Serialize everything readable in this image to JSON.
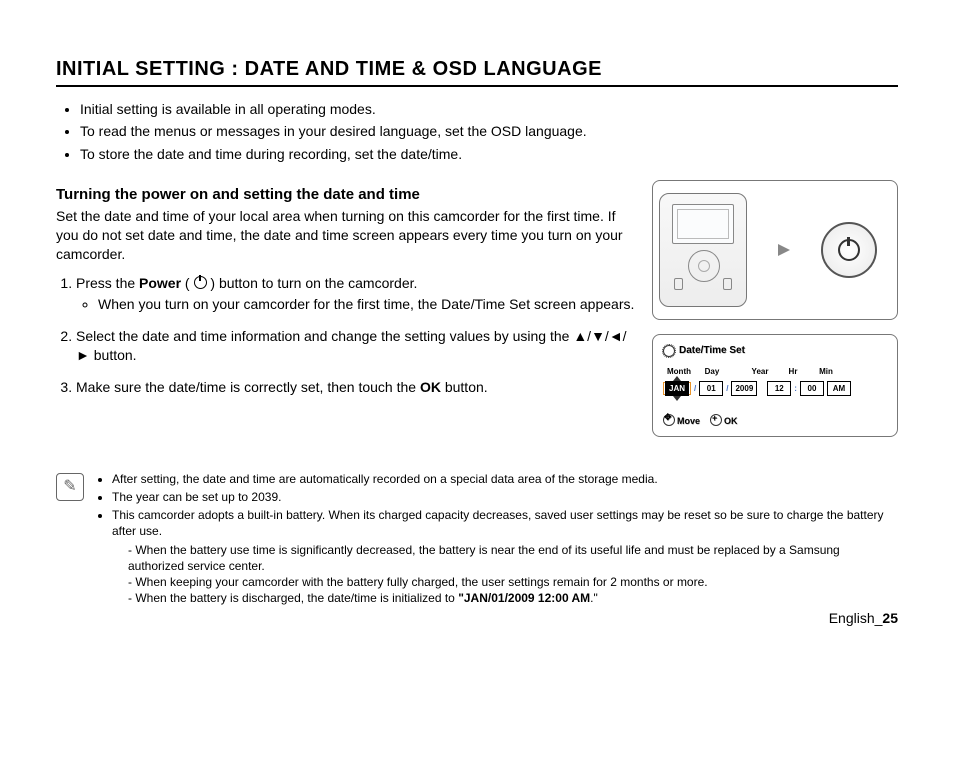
{
  "title": "INITIAL SETTING : DATE AND TIME & OSD LANGUAGE",
  "intro": {
    "i1": "Initial setting is available in all operating modes.",
    "i2": "To read the menus or messages in your desired language, set the OSD language.",
    "i3": "To store the date and time during recording, set the date/time."
  },
  "section": {
    "heading": "Turning the power on and setting the date and time",
    "body": "Set the date and time of your local area when turning on this camcorder for the first time. If you do not set date and time, the date and time screen appears every time you turn on your camcorder.",
    "step1_a": "Press the ",
    "step1_power": "Power",
    "step1_b": " ( ",
    "step1_c": " ) button to turn on the camcorder.",
    "step1_sub": "When you turn on your camcorder for the first time, the Date/Time Set screen appears.",
    "step2_a": "Select the date and time information and change the setting values by using the ",
    "step2_arrows": "▲/▼/◄/►",
    "step2_b": " button.",
    "step3_a": "Make sure the date/time is correctly set, then touch the ",
    "step3_ok": "OK",
    "step3_b": " button."
  },
  "osd": {
    "title": "Date/Time Set",
    "labels": {
      "month": "Month",
      "day": "Day",
      "year": "Year",
      "hr": "Hr",
      "min": "Min"
    },
    "values": {
      "month": "JAN",
      "day": "01",
      "year": "2009",
      "hr": "12",
      "min": "00",
      "ampm": "AM"
    },
    "move": "Move",
    "ok": "OK"
  },
  "notes": {
    "n1": "After setting, the date and time are automatically recorded on a special data area of the storage media.",
    "n2": "The year can be set up to 2039.",
    "n3": "This camcorder adopts a built-in battery. When its charged capacity decreases, saved user settings may be reset so be sure to charge the battery after use.",
    "n3a": "When the battery use time is significantly decreased, the battery is near the end of its useful life and must be replaced by a Samsung authorized service center.",
    "n3b": "When keeping your camcorder with the battery fully charged, the user settings remain for 2 months or more.",
    "n3c_a": "When the battery is discharged, the date/time is initialized to ",
    "n3c_bold": "\"JAN/01/2009 12:00 AM",
    "n3c_b": ".\""
  },
  "footer": {
    "lang": "English",
    "sep": "_",
    "page": "25"
  }
}
